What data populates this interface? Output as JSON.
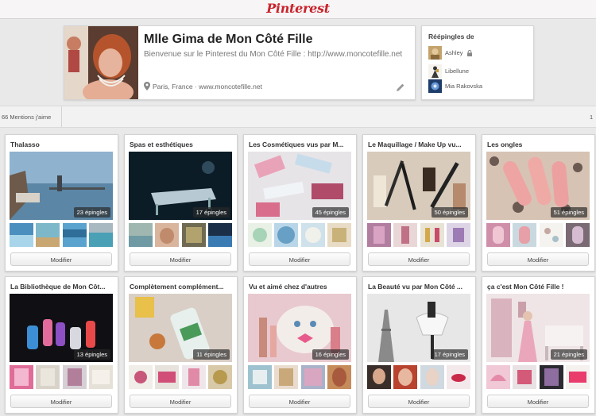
{
  "header": {
    "logo": "Pinterest"
  },
  "profile": {
    "name": "Mlle Gima de Mon Côté Fille",
    "description": "Bienvenue sur le Pinterest du Mon Côté Fille : http://www.moncotefille.net",
    "location": "Paris, France · www.moncotefille.net"
  },
  "repins": {
    "title": "Réépingles de",
    "users": [
      {
        "name": "Ashley"
      },
      {
        "name": "Libellune"
      },
      {
        "name": "Mia Rakovska"
      }
    ]
  },
  "stats": {
    "likes": "66 Mentions j'aime",
    "right_fragment": "1"
  },
  "boards": [
    {
      "title": "Thalasso",
      "count": "23 épingles",
      "button": "Modifier"
    },
    {
      "title": "Spas et esthétiques",
      "count": "17 épingles",
      "button": "Modifier"
    },
    {
      "title": "Les Cosmétiques vus par M...",
      "count": "45 épingles",
      "button": "Modifier"
    },
    {
      "title": "Le Maquillage / Make Up vu...",
      "count": "50 épingles",
      "button": "Modifier"
    },
    {
      "title": "Les ongles",
      "count": "51 épingles",
      "button": "Modifier"
    },
    {
      "title": "La Bibliothèque de Mon Côt...",
      "count": "13 épingles",
      "button": "Modifier"
    },
    {
      "title": "Complètement complément...",
      "count": "11 épingles",
      "button": "Modifier"
    },
    {
      "title": "Vu et aimé chez d'autres",
      "count": "16 épingles",
      "button": "Modifier"
    },
    {
      "title": "La Beauté vu par Mon Côté ...",
      "count": "17 épingles",
      "button": "Modifier"
    },
    {
      "title": "ça c'est Mon Côté Fille !",
      "count": "21 épingles",
      "button": "Modifier"
    }
  ],
  "colors": {
    "brand": "#c8232c",
    "background": "#e9e9e9"
  }
}
